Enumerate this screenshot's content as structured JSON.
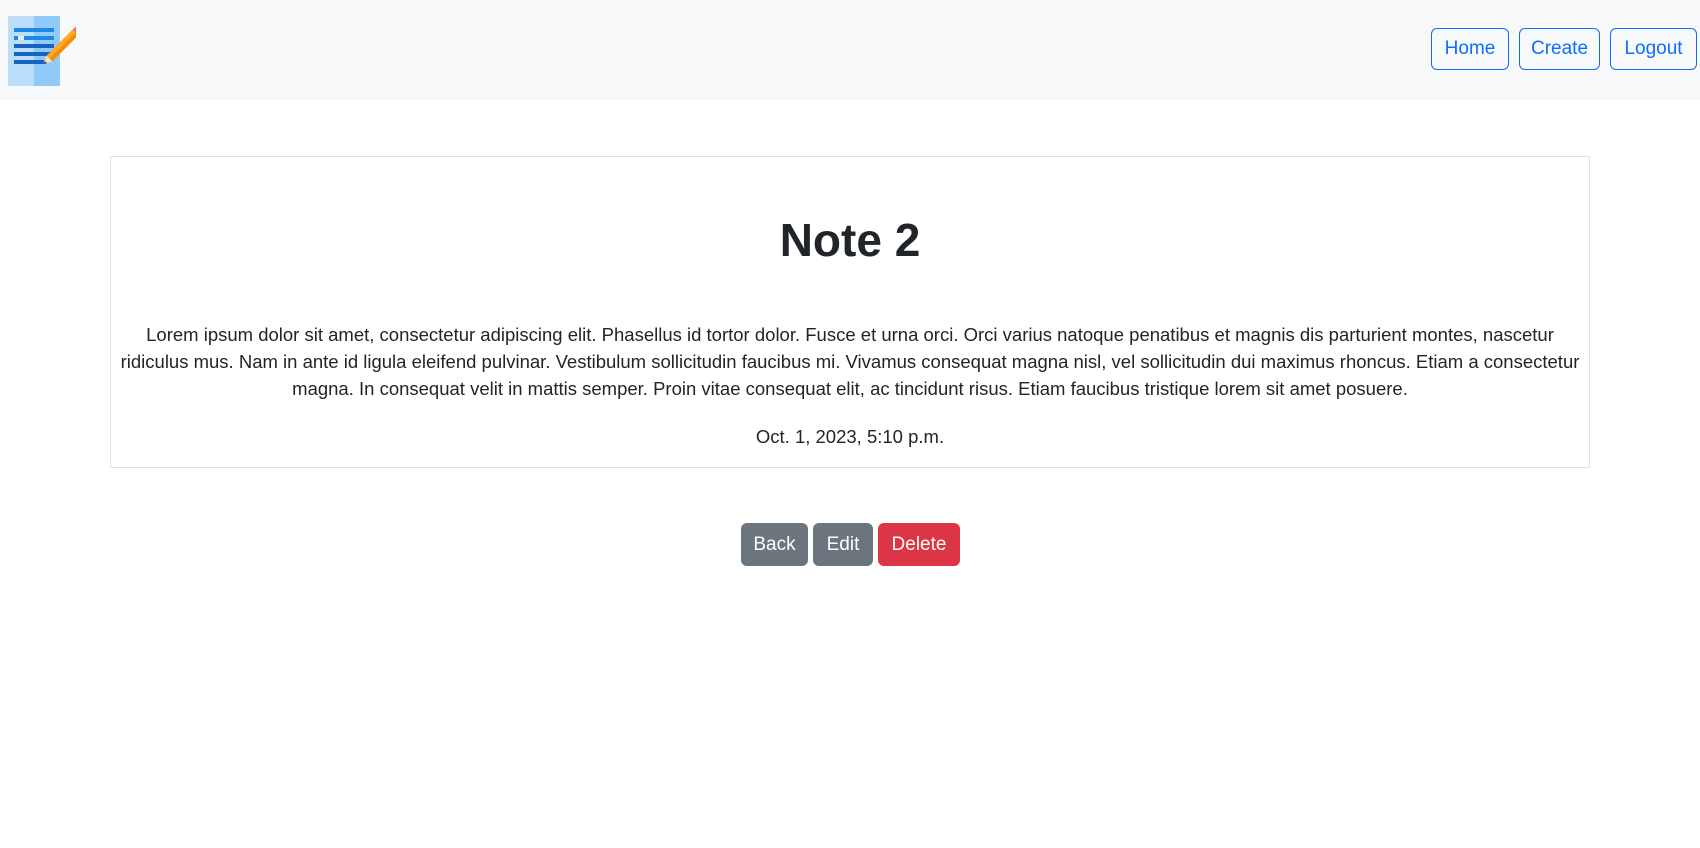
{
  "navbar": {
    "logo_icon": "notepad-pencil-icon",
    "home_label": "Home",
    "create_label": "Create",
    "logout_label": "Logout"
  },
  "note": {
    "title": "Note 2",
    "body": "Lorem ipsum dolor sit amet, consectetur adipiscing elit. Phasellus id tortor dolor. Fusce et urna orci. Orci varius natoque penatibus et magnis dis parturient montes, nascetur ridiculus mus. Nam in ante id ligula eleifend pulvinar. Vestibulum sollicitudin faucibus mi. Vivamus consequat magna nisl, vel sollicitudin dui maximus rhoncus. Etiam a consectetur magna. In consequat velit in mattis semper. Proin vitae consequat elit, ac tincidunt risus. Etiam faucibus tristique lorem sit amet posuere.",
    "date": "Oct. 1, 2023, 5:10 p.m."
  },
  "actions": {
    "back_label": "Back",
    "edit_label": "Edit",
    "delete_label": "Delete"
  },
  "colors": {
    "primary": "#0d6efd",
    "secondary": "#6c757d",
    "danger": "#dc3545",
    "navbar_bg": "#f8f9fa"
  }
}
